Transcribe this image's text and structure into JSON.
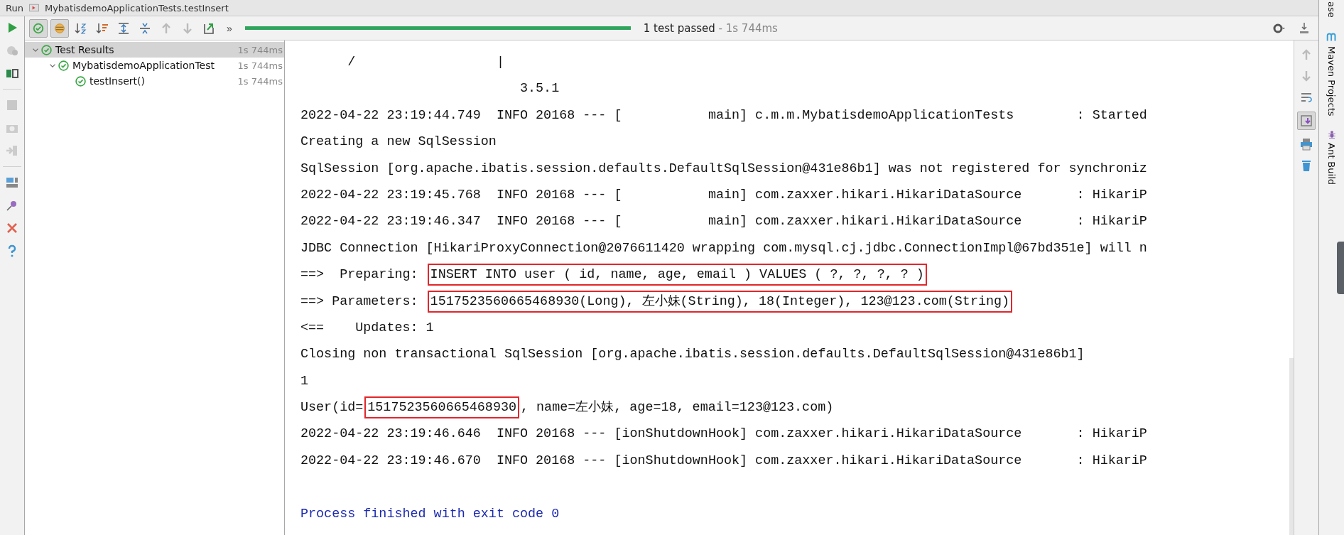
{
  "window": {
    "title_label": "Run",
    "title": "MybatisdemoApplicationTests.testInsert"
  },
  "toolbar": {
    "filters": [
      {
        "on": true
      },
      {
        "on": true
      }
    ],
    "more": "»",
    "progress": {
      "level": 1.0,
      "status": "1 test passed",
      "duration": " - 1s 744ms"
    }
  },
  "tree": {
    "items": [
      {
        "label": "Test Results",
        "time": "1s 744ms",
        "expanded": true,
        "selected": true,
        "children": [
          {
            "label": "MybatisdemoApplicationTest",
            "time": "1s 744ms",
            "expanded": true,
            "selected": false,
            "children": [
              {
                "label": "testInsert()",
                "time": "1s 744ms",
                "selected": false
              }
            ]
          }
        ]
      }
    ]
  },
  "console": {
    "lines": [
      {
        "kind": "log",
        "segments": [
          {
            "text": "      /                  |",
            "boxed": false
          }
        ]
      },
      {
        "kind": "log",
        "segments": [
          {
            "text": "                            3.5.1",
            "boxed": false
          }
        ]
      },
      {
        "kind": "log",
        "segments": [
          {
            "text": "2022-04-22 23:19:44.749  INFO 20168 --- [           main] c.m.m.MybatisdemoApplicationTests        : Started",
            "boxed": false
          }
        ]
      },
      {
        "kind": "log",
        "segments": [
          {
            "text": "Creating a new SqlSession",
            "boxed": false
          }
        ]
      },
      {
        "kind": "log",
        "segments": [
          {
            "text": "SqlSession [org.apache.ibatis.session.defaults.DefaultSqlSession@431e86b1] was not registered for synchroniz",
            "boxed": false
          }
        ]
      },
      {
        "kind": "log",
        "segments": [
          {
            "text": "2022-04-22 23:19:45.768  INFO 20168 --- [           main] com.zaxxer.hikari.HikariDataSource       : HikariP",
            "boxed": false
          }
        ]
      },
      {
        "kind": "log",
        "segments": [
          {
            "text": "2022-04-22 23:19:46.347  INFO 20168 --- [           main] com.zaxxer.hikari.HikariDataSource       : HikariP",
            "boxed": false
          }
        ]
      },
      {
        "kind": "log",
        "segments": [
          {
            "text": "JDBC Connection [HikariProxyConnection@2076611420 wrapping com.mysql.cj.jdbc.ConnectionImpl@67bd351e] will n",
            "boxed": false
          }
        ]
      },
      {
        "kind": "log",
        "segments": [
          {
            "text": "==>  Preparing: ",
            "boxed": false
          },
          {
            "text": "INSERT INTO user ( id, name, age, email ) VALUES ( ?, ?, ?, ? )",
            "boxed": true
          }
        ]
      },
      {
        "kind": "log",
        "segments": [
          {
            "text": "==> Parameters: ",
            "boxed": false
          },
          {
            "text": "1517523560665468930(Long), 左小妹(String), 18(Integer), 123@123.com(String)",
            "boxed": true
          }
        ]
      },
      {
        "kind": "log",
        "segments": [
          {
            "text": "<==    Updates: 1",
            "boxed": false
          }
        ]
      },
      {
        "kind": "log",
        "segments": [
          {
            "text": "Closing non transactional SqlSession [org.apache.ibatis.session.defaults.DefaultSqlSession@431e86b1]",
            "boxed": false
          }
        ]
      },
      {
        "kind": "log",
        "segments": [
          {
            "text": "1",
            "boxed": false
          }
        ]
      },
      {
        "kind": "log",
        "segments": [
          {
            "text": "User(id=",
            "boxed": false
          },
          {
            "text": "1517523560665468930",
            "boxed": true
          },
          {
            "text": ", name=左小妹, age=18, email=123@123.com)",
            "boxed": false
          }
        ]
      },
      {
        "kind": "log",
        "segments": [
          {
            "text": "2022-04-22 23:19:46.646  INFO 20168 --- [ionShutdownHook] com.zaxxer.hikari.HikariDataSource       : HikariP",
            "boxed": false
          }
        ]
      },
      {
        "kind": "log",
        "segments": [
          {
            "text": "2022-04-22 23:19:46.670  INFO 20168 --- [ionShutdownHook] com.zaxxer.hikari.HikariDataSource       : HikariP",
            "boxed": false
          }
        ]
      },
      {
        "kind": "exit",
        "segments": [
          {
            "text": "Process finished with exit code 0",
            "boxed": false
          }
        ]
      }
    ]
  },
  "console_tools": {
    "scroll_to_end_on": true
  },
  "side_panel": [
    {
      "kind": "plain",
      "label": "ase"
    },
    {
      "kind": "maven",
      "label": "Maven Projects"
    },
    {
      "kind": "ant",
      "label": "Ant Build"
    }
  ]
}
